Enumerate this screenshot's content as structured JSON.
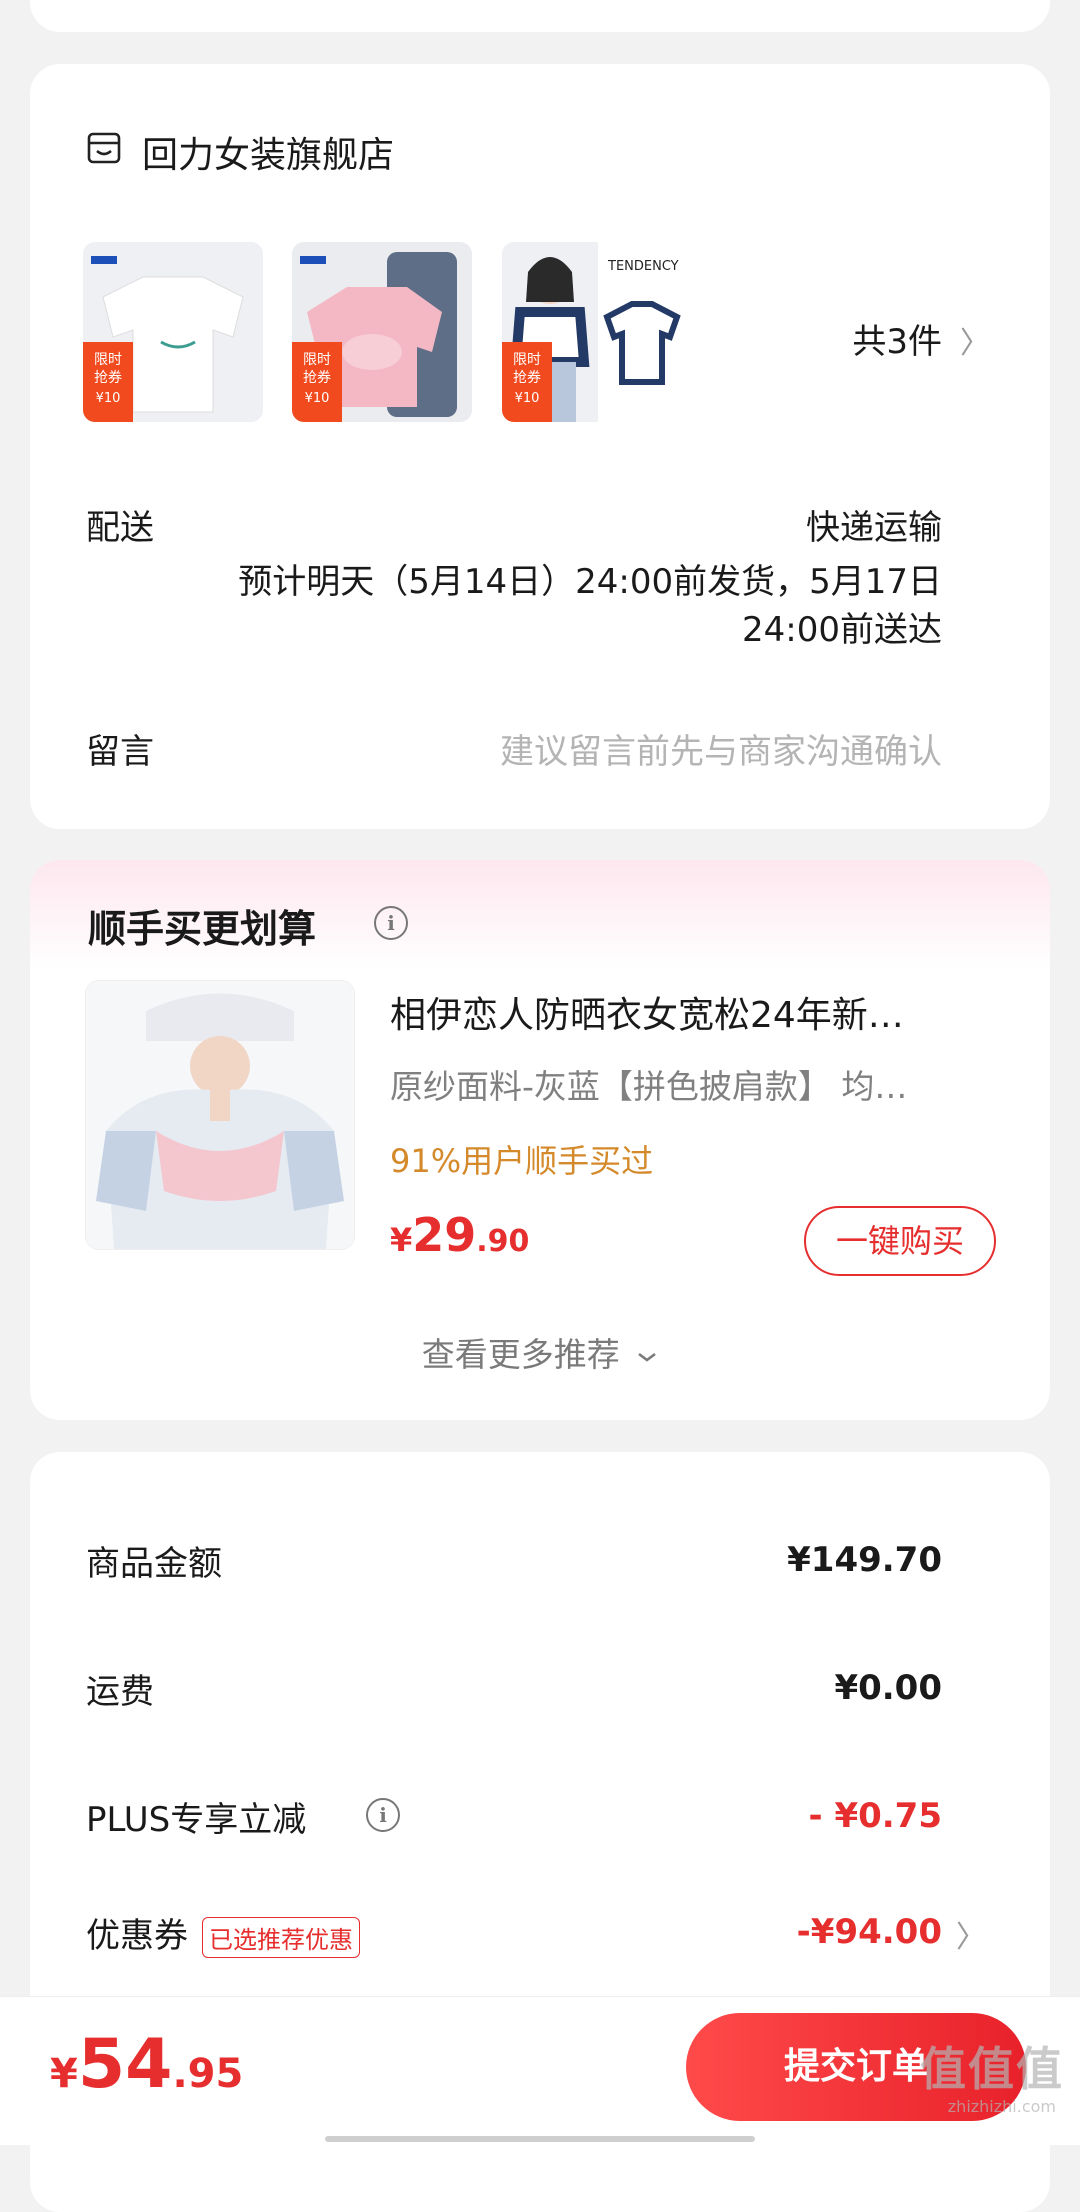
{
  "store": {
    "name": "回力女装旗舰店",
    "item_count": "共3件",
    "promo_badge": {
      "line1": "限时",
      "line2": "抢券",
      "amount": "¥10"
    },
    "third_item_brand": "TENDENCY"
  },
  "delivery": {
    "label": "配送",
    "method": "快递运输",
    "eta": "预计明天（5月14日）24:00前发货，5月17日24:00前送达"
  },
  "message": {
    "label": "留言",
    "placeholder": "建议留言前先与商家沟通确认"
  },
  "recommend": {
    "title": "顺手买更划算",
    "info_glyph": "i",
    "product_name": "相伊恋人防晒衣女宽松24年新…",
    "product_spec": "原纱面料-灰蓝【拼色披肩款】   均…",
    "hint": "91%用户顺手买过",
    "price_symbol": "¥",
    "price_int": "29",
    "price_dec": ".90",
    "buy_label": "一键购买",
    "more_label": "查看更多推荐"
  },
  "summary": {
    "goods_label": "商品金额",
    "goods_value": "¥149.70",
    "shipping_label": "运费",
    "shipping_value": "¥0.00",
    "plus_label": "PLUS专享立减",
    "plus_value": "- ¥0.75",
    "coupon_label": "优惠券",
    "coupon_tag": "已选推荐优惠",
    "coupon_value": "-¥94.00"
  },
  "footer": {
    "total_symbol": "¥",
    "total_int": "54",
    "total_dec": ".95",
    "submit_label": "提交订单",
    "watermark": "值值值",
    "watermark_sub": "zhizhizhi.com"
  },
  "colors": {
    "accent": "#e62e2e",
    "hint": "#d4892a",
    "placeholder": "#b4b4b4"
  }
}
